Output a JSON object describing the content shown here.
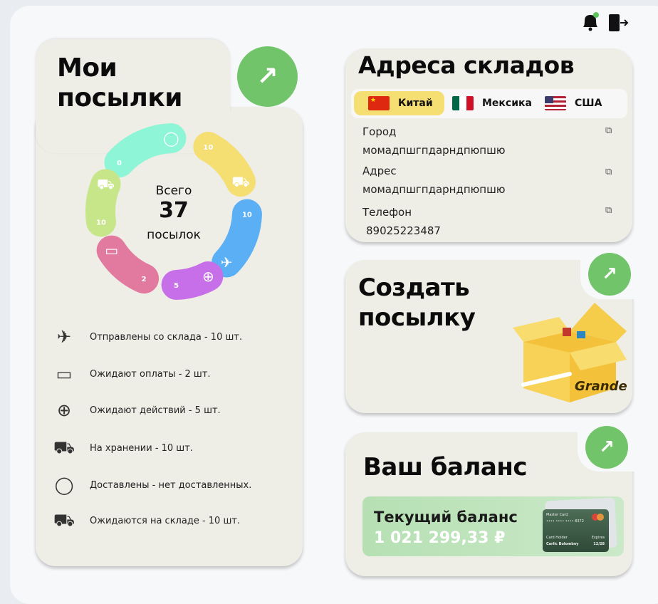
{
  "header": {
    "bell_icon": "bell-icon",
    "logout_icon": "logout-icon"
  },
  "parcels": {
    "title_line1": "Мои",
    "title_line2": "посылки",
    "total_label": "Всего",
    "total": "37",
    "total_unit": "посылок",
    "segments": [
      {
        "key": "delivered",
        "value": "0",
        "color": "#8ef5d7",
        "icon": "check-circle-icon"
      },
      {
        "key": "storage",
        "value": "10",
        "color": "#f5de72",
        "icon": "cart-icon"
      },
      {
        "key": "sent",
        "value": "10",
        "color": "#5aaff5",
        "icon": "plane-icon"
      },
      {
        "key": "awaiting_action",
        "value": "5",
        "color": "#c76fe8",
        "icon": "plus-circle-icon"
      },
      {
        "key": "awaiting_payment",
        "value": "2",
        "color": "#e2799e",
        "icon": "card-icon"
      },
      {
        "key": "awaiting_warehouse",
        "value": "10",
        "color": "#c7e68a",
        "icon": "truck-clock-icon"
      }
    ],
    "legend": [
      {
        "icon": "plane-icon",
        "text": "Отправлены со склада - 10 шт."
      },
      {
        "icon": "card-icon",
        "text": "Ожидают оплаты - 2 шт."
      },
      {
        "icon": "plus-circle-icon",
        "text": "Ожидают действий - 5 шт."
      },
      {
        "icon": "cart-icon",
        "text": "На хранении - 10 шт."
      },
      {
        "icon": "check-circle-icon",
        "text": "Доставлены - нет доставленных."
      },
      {
        "icon": "truck-clock-icon",
        "text": "Ожидаются на складе - 10 шт."
      }
    ]
  },
  "warehouses": {
    "title": "Адреса складов",
    "tabs": [
      {
        "label": "Китай",
        "active": true
      },
      {
        "label": "Мексика",
        "active": false
      },
      {
        "label": "США",
        "active": false
      }
    ],
    "city_label": "Город",
    "city_value": "момадпшгпдарндпюпшю",
    "address_label": "Адрес",
    "address_value": "момадпшгпдарндпюпшю",
    "phone_label": "Телефон",
    "phone_value": "89025223487"
  },
  "create": {
    "title_line1": "Создать",
    "title_line2": "посылку",
    "box_logo": "Grande"
  },
  "balance": {
    "title": "Ваш баланс",
    "current_label": "Текущий баланс",
    "amount": "1 021 299,33 ₽",
    "card": {
      "brand": "Master Card",
      "number": "•••• •••• •••• 8372",
      "holder_label": "Card Holder",
      "holder": "Carlic Bolomboy",
      "expires_label": "Expires",
      "expires": "12/28"
    }
  },
  "colors": {
    "accent_green": "#72c46b",
    "active_tab": "#f5de72",
    "panel": "#eeede6"
  }
}
